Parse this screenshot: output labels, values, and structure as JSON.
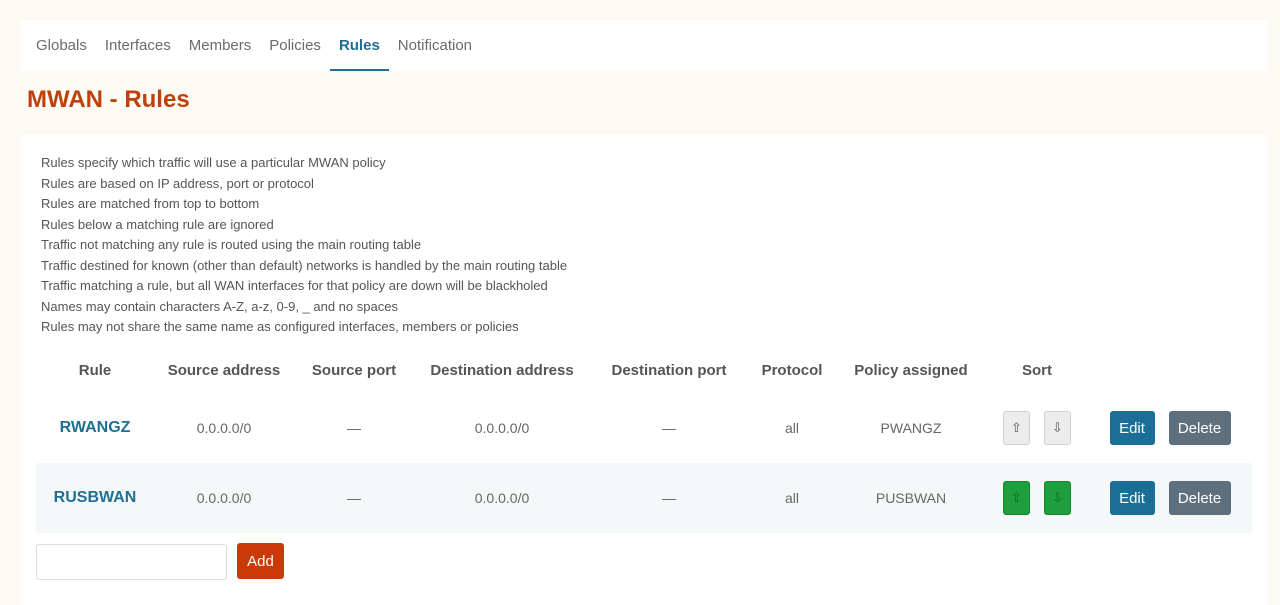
{
  "tabs": [
    {
      "label": "Globals"
    },
    {
      "label": "Interfaces"
    },
    {
      "label": "Members"
    },
    {
      "label": "Policies"
    },
    {
      "label": "Rules",
      "active": true
    },
    {
      "label": "Notification"
    }
  ],
  "page_title": "MWAN - Rules",
  "description": [
    "Rules specify which traffic will use a particular MWAN policy",
    "Rules are based on IP address, port or protocol",
    "Rules are matched from top to bottom",
    "Rules below a matching rule are ignored",
    "Traffic not matching any rule is routed using the main routing table",
    "Traffic destined for known (other than default) networks is handled by the main routing table",
    "Traffic matching a rule, but all WAN interfaces for that policy are down will be blackholed",
    "Names may contain characters A-Z, a-z, 0-9, _ and no spaces",
    "Rules may not share the same name as configured interfaces, members or policies"
  ],
  "table": {
    "headers": [
      "Rule",
      "Source address",
      "Source port",
      "Destination address",
      "Destination port",
      "Protocol",
      "Policy assigned",
      "Sort",
      ""
    ],
    "rows": [
      {
        "name": "RWANGZ",
        "src_addr": "0.0.0.0/0",
        "src_port": "—",
        "dst_addr": "0.0.0.0/0",
        "dst_port": "—",
        "protocol": "all",
        "policy": "PWANGZ",
        "sort_style": "gray"
      },
      {
        "name": "RUSBWAN",
        "src_addr": "0.0.0.0/0",
        "src_port": "—",
        "dst_addr": "0.0.0.0/0",
        "dst_port": "—",
        "protocol": "all",
        "policy": "PUSBWAN",
        "sort_style": "green"
      }
    ],
    "sort_up_glyph": "⇧",
    "sort_down_glyph": "⇩",
    "edit_label": "Edit",
    "delete_label": "Delete"
  },
  "add": {
    "input_value": "",
    "input_placeholder": "",
    "button_label": "Add"
  },
  "colors": {
    "accent": "#1f6f94",
    "title": "#c0400a",
    "add_button": "#c93a08",
    "edit_button": "#1b6f96",
    "delete_button": "#5e707d",
    "sort_green": "#1f9e3e"
  }
}
